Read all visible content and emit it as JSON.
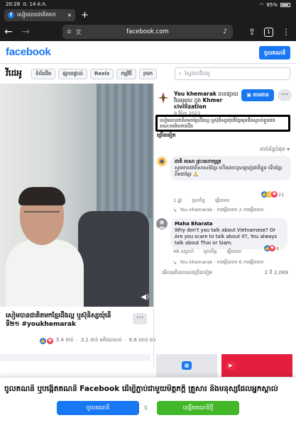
{
  "status": {
    "time": "20:28",
    "date": "ថ. 14 ត.ក.",
    "battery": "85%"
  },
  "browser": {
    "tab_title": "សៀមបានជាគិតរាក",
    "url": "facebook.com"
  },
  "header": {
    "logo": "facebook",
    "login_label": "ចូលគណនី"
  },
  "video_nav": {
    "title": "វីដេអូ",
    "tabs": [
      "ទំព័រដើម",
      "ផ្សាយផ្ទាល់",
      "Reels",
      "កម្មវិធី",
      "រុករក"
    ],
    "search_placeholder": "ស្វែងរកវីដេអូ"
  },
  "video": {
    "caption": "សៀមបានជាគិតមកខ្មែរដឹងល្អ ឬស៊ុនិស្សយ៉ុនើ ទី២១ ",
    "hashtag": "#youkhemarak",
    "stats_reactions": "5.4 ពាន់",
    "stats_comments": "3.1 ពាន់ មតិយោបល់",
    "stats_views": "6.8 លាន ដង"
  },
  "author": {
    "name": "You khemarak",
    "action": "បានផ្សាយវីដេអូមួយ ក្នុង",
    "group": "Khmer civilization",
    "date": "9 វិច្ឆិកា 2023",
    "follow_label": "តាមដាន"
  },
  "post": {
    "description": "សៀមបានជាគិតមកខ្មែរដឹងល្អ ឬស៊ុនិស្សយ៉ុនើខ្មែរមុននឹងស្គាល់ខ្លួនឯង ខណៈគេមិនទាន់ដឹង",
    "see_more": "ច្រើនទៀត",
    "sort_label": "ពាក់ព័ន្ធបំផុត ▾"
  },
  "comments": [
    {
      "name": "ជាតិ ភាសា ព្រះមហាក្សត្រ",
      "text": "សូមមានជាតិសាសន៍ខ្មែរ ហើយចេះស្រឡាញ់ជាតិខ្លួន ទើបខ្មែរពិតជាខ្មែរ 🙏",
      "age": "1 ឆ្នាំ",
      "like": "ចូលចិត្ត",
      "reply": "ឆ្លើយតប",
      "reactions": "21",
      "thread": "You khemarak · ការឆ្លើយតប 2 ការឆ្លើយតប"
    },
    {
      "name": "Maha Bharata",
      "text": "Why don't you talk about Vietnamese? Or Are you scare to talk about it?, You always talk about Thai or Siam.",
      "age": "48 សប្ដាហ៍",
      "like": "ចូលចិត្ត",
      "reply": "ឆ្លើយតប",
      "reactions": "8",
      "thread": "You khemarak · ការឆ្លើយតប 6 ការឆ្លើយតប"
    }
  ],
  "more_comments": "មើលមតិយោបល់ច្រើនទៀត",
  "comment_count": "2 ពី 2,069",
  "banner": {
    "message": "ចូលគណនី ឬបង្កើតគណនី Facebook ដើម្បីភ្ជាប់ជាមួយមិត្តភក្តិ គ្រួសារ និងមនុស្សដែលអ្នកស្គាល់",
    "login_label": "ចូលគណនី",
    "or_label": "ឬ",
    "create_label": "បង្កើតគណនីថ្មី"
  },
  "colors": {
    "brand": "#1877f2",
    "create": "#42b72a",
    "highlight_border": "#000000"
  }
}
